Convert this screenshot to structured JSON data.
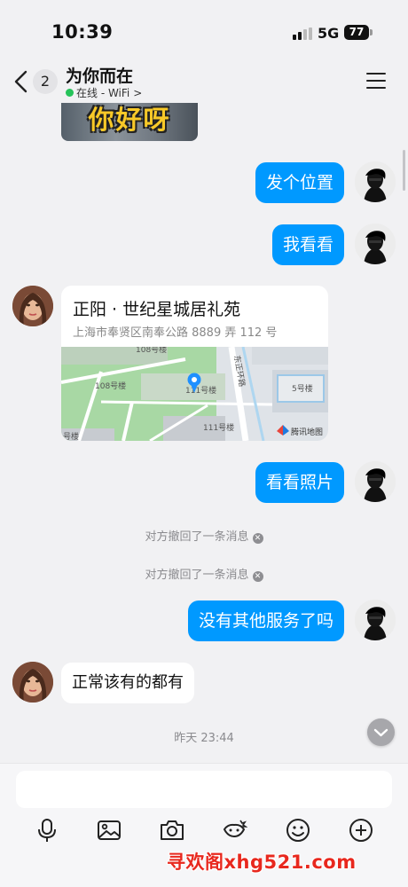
{
  "status_bar": {
    "time": "10:39",
    "network": "5G",
    "battery": "77"
  },
  "header": {
    "unread_count": "2",
    "title": "为你而在",
    "presence": "在线 - WiFi",
    "presence_chevron": ">"
  },
  "messages": {
    "sticker_text": "你好呀",
    "out_1": "发个位置",
    "out_2": "我看看",
    "location": {
      "name": "正阳 · 世纪星城居礼苑",
      "address": "上海市奉贤区南奉公路 8889 弄 112 号",
      "map_labels": {
        "b1": "108号楼",
        "b2": "108号楼",
        "b3": "111号楼",
        "b4": "111号楼",
        "b5": "5号楼",
        "b6": "号楼",
        "road": "东正环路",
        "provider": "腾讯地图"
      }
    },
    "out_3": "看看照片",
    "recall_1": "对方撤回了一条消息",
    "recall_2": "对方撤回了一条消息",
    "out_4": "没有其他服务了吗",
    "in_1": "正常该有的都有",
    "timestamp": "昨天 23:44"
  },
  "input": {
    "placeholder": ""
  },
  "toolbar_icons": [
    "microphone-icon",
    "image-icon",
    "camera-icon",
    "red-packet-icon",
    "emoji-icon",
    "plus-icon"
  ],
  "watermark": "寻欢阁xhg521.com",
  "colors": {
    "accent": "#0099ff",
    "online": "#26c35a",
    "watermark": "#e8281e"
  }
}
